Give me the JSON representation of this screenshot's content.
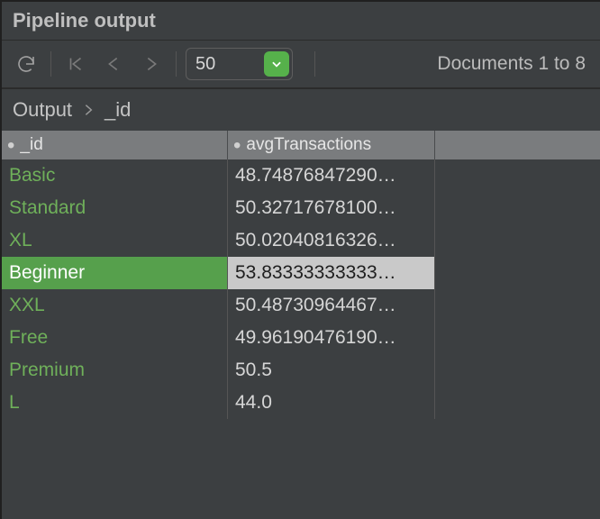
{
  "panel": {
    "title": "Pipeline output"
  },
  "toolbar": {
    "page_size": "50",
    "status": "Documents 1 to 8"
  },
  "breadcrumb": {
    "root": "Output",
    "leaf": "_id"
  },
  "table": {
    "columns": [
      {
        "label": "_id"
      },
      {
        "label": "avgTransactions"
      }
    ],
    "rows": [
      {
        "id": "Basic",
        "value": "48.74876847290…",
        "selected": false
      },
      {
        "id": "Standard",
        "value": "50.32717678100…",
        "selected": false
      },
      {
        "id": "XL",
        "value": "50.02040816326…",
        "selected": false
      },
      {
        "id": "Beginner",
        "value": "53.83333333333…",
        "selected": true
      },
      {
        "id": "XXL",
        "value": "50.48730964467…",
        "selected": false
      },
      {
        "id": "Free",
        "value": "49.96190476190…",
        "selected": false
      },
      {
        "id": "Premium",
        "value": "50.5",
        "selected": false
      },
      {
        "id": "L",
        "value": "44.0",
        "selected": false
      }
    ]
  }
}
